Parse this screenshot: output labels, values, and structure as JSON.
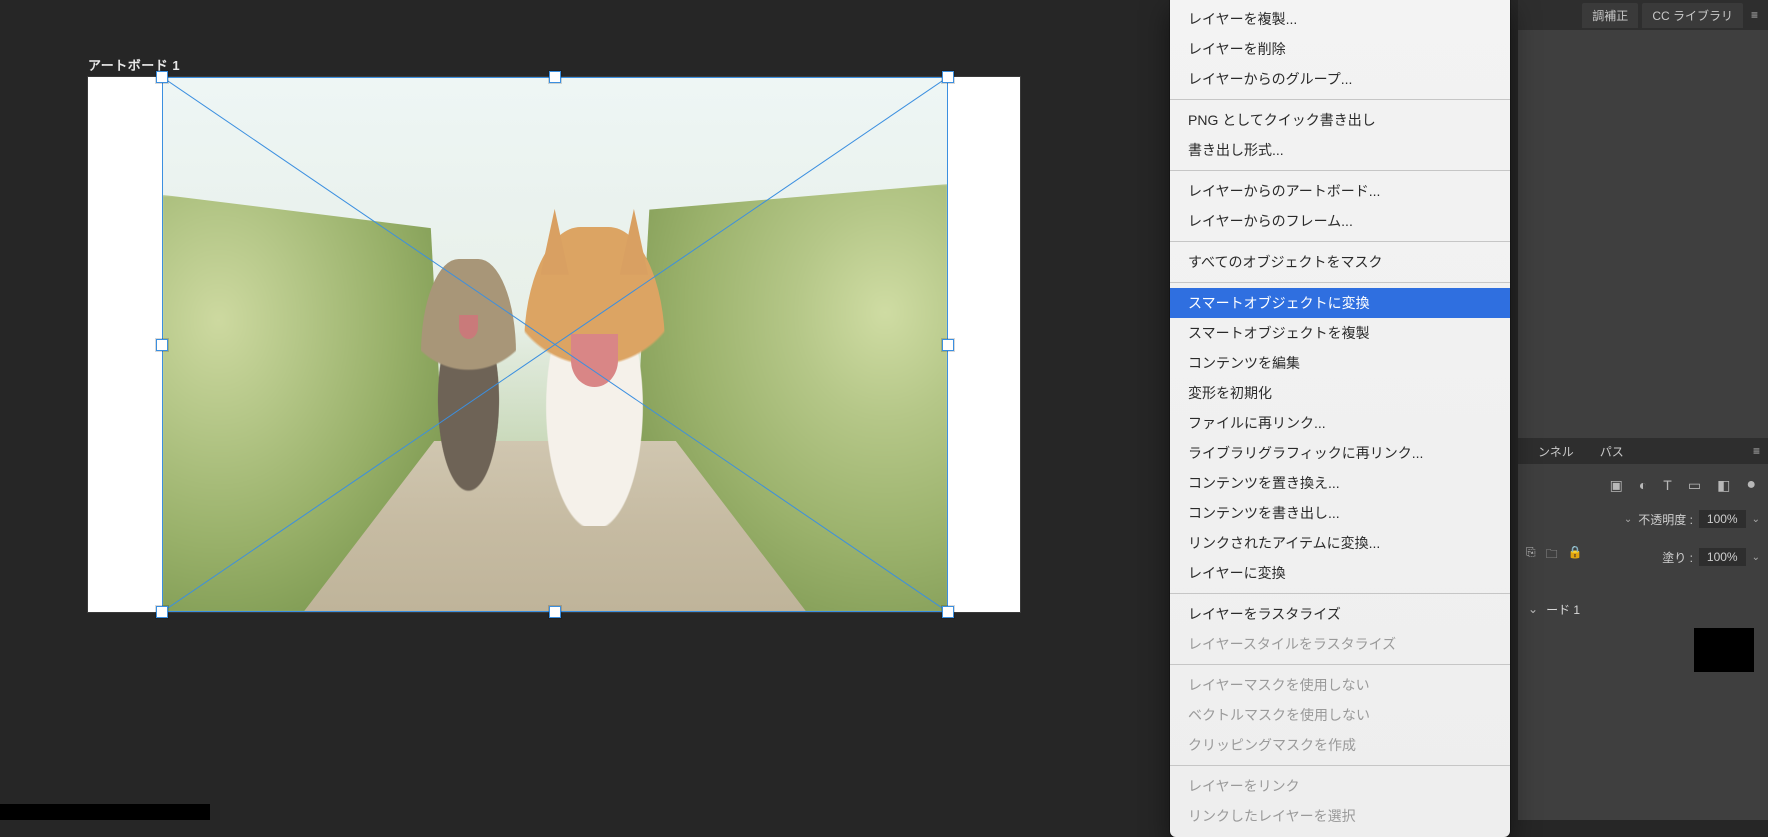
{
  "artboard": {
    "label": "アートボード 1"
  },
  "contextMenu": {
    "items": [
      {
        "label": "レイヤーを複製...",
        "type": "item"
      },
      {
        "label": "レイヤーを削除",
        "type": "item"
      },
      {
        "label": "レイヤーからのグループ...",
        "type": "item"
      },
      {
        "type": "sep"
      },
      {
        "label": "PNG としてクイック書き出し",
        "type": "item"
      },
      {
        "label": "書き出し形式...",
        "type": "item"
      },
      {
        "type": "sep"
      },
      {
        "label": "レイヤーからのアートボード...",
        "type": "item"
      },
      {
        "label": "レイヤーからのフレーム...",
        "type": "item"
      },
      {
        "type": "sep"
      },
      {
        "label": "すべてのオブジェクトをマスク",
        "type": "item"
      },
      {
        "type": "sep"
      },
      {
        "label": "スマートオブジェクトに変換",
        "type": "item",
        "highlight": true
      },
      {
        "label": "スマートオブジェクトを複製",
        "type": "item"
      },
      {
        "label": "コンテンツを編集",
        "type": "item"
      },
      {
        "label": "変形を初期化",
        "type": "item"
      },
      {
        "label": "ファイルに再リンク...",
        "type": "item"
      },
      {
        "label": "ライブラリグラフィックに再リンク...",
        "type": "item"
      },
      {
        "label": "コンテンツを置き換え...",
        "type": "item"
      },
      {
        "label": "コンテンツを書き出し...",
        "type": "item"
      },
      {
        "label": "リンクされたアイテムに変換...",
        "type": "item"
      },
      {
        "label": "レイヤーに変換",
        "type": "item"
      },
      {
        "type": "sep"
      },
      {
        "label": "レイヤーをラスタライズ",
        "type": "item"
      },
      {
        "label": "レイヤースタイルをラスタライズ",
        "type": "item",
        "disabled": true
      },
      {
        "type": "sep"
      },
      {
        "label": "レイヤーマスクを使用しない",
        "type": "item",
        "disabled": true
      },
      {
        "label": "ベクトルマスクを使用しない",
        "type": "item",
        "disabled": true
      },
      {
        "label": "クリッピングマスクを作成",
        "type": "item",
        "disabled": true
      },
      {
        "type": "sep"
      },
      {
        "label": "レイヤーをリンク",
        "type": "item",
        "disabled": true
      },
      {
        "label": "リンクしたレイヤーを選択",
        "type": "item",
        "disabled": true
      }
    ]
  },
  "rightTabs": {
    "adjust": "調補正",
    "ccLib": "CC ライブラリ"
  },
  "layersPanel": {
    "tabChannels": "ンネル",
    "tabPaths": "パス",
    "opacityLabel": "不透明度 :",
    "opacityValue": "100%",
    "fillLabel": "塗り :",
    "fillValue": "100%",
    "artboardEntry": "ード 1"
  },
  "colors": {
    "selection": "#3b8fe0",
    "menuHighlight": "#2f6fe0"
  }
}
